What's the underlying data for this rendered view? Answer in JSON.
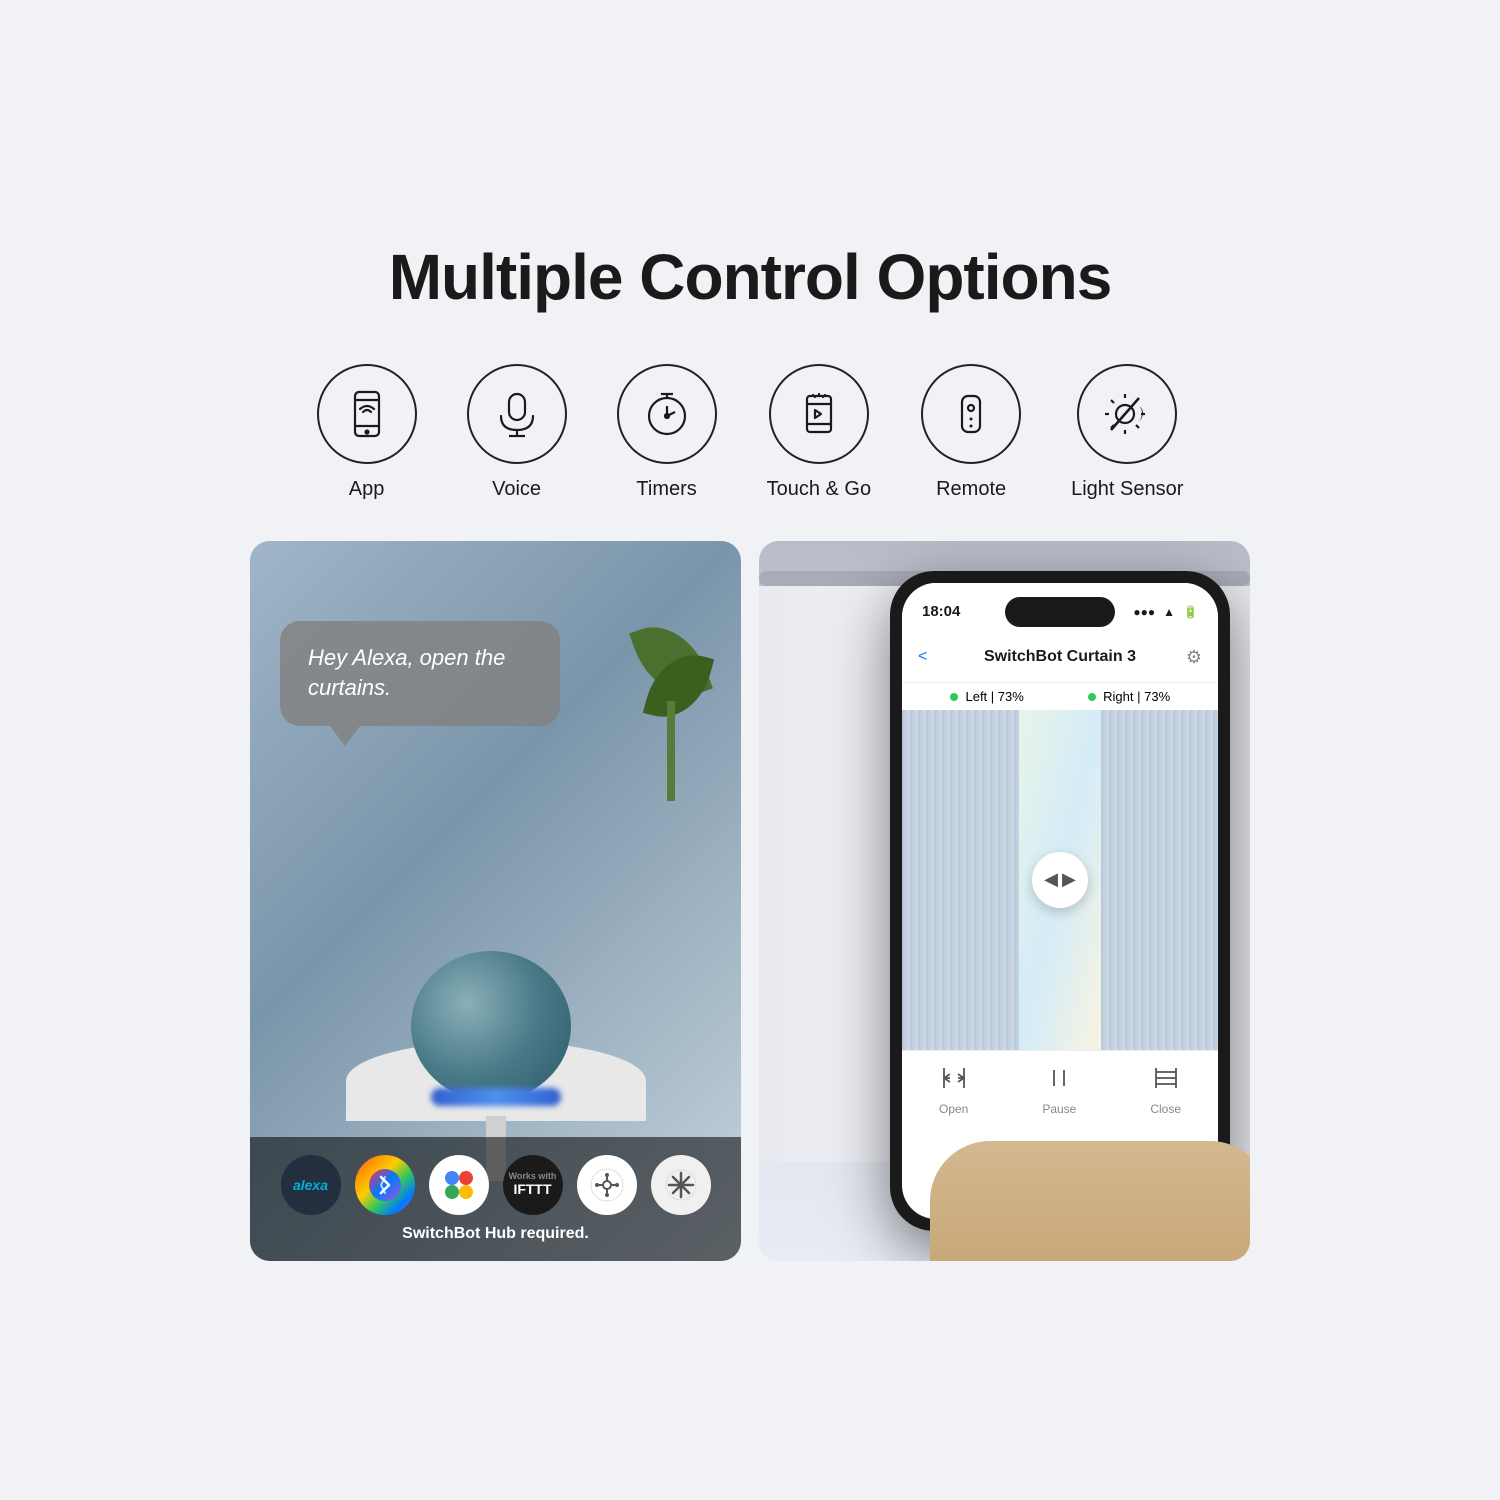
{
  "page": {
    "background_color": "#f0f2f5"
  },
  "header": {
    "title": "Multiple Control Options"
  },
  "control_icons": [
    {
      "id": "app",
      "label": "App",
      "icon": "smartphone-icon"
    },
    {
      "id": "voice",
      "label": "Voice",
      "icon": "microphone-icon"
    },
    {
      "id": "timers",
      "label": "Timers",
      "icon": "timer-icon"
    },
    {
      "id": "touch-go",
      "label": "Touch & Go",
      "icon": "touch-icon"
    },
    {
      "id": "remote",
      "label": "Remote",
      "icon": "remote-icon"
    },
    {
      "id": "light-sensor",
      "label": "Light Sensor",
      "icon": "light-sensor-icon"
    }
  ],
  "left_panel": {
    "speech_bubble": {
      "text": "Hey Alexa, open the curtains."
    },
    "logos": [
      {
        "id": "alexa",
        "label": "alexa"
      },
      {
        "id": "shortcuts",
        "label": "shortcuts"
      },
      {
        "id": "google",
        "label": "google"
      },
      {
        "id": "ifttt",
        "label": "Works with IFTTT"
      },
      {
        "id": "matter",
        "label": "matter"
      },
      {
        "id": "homekit",
        "label": "homekit"
      }
    ],
    "hub_required_text": "SwitchBot Hub required."
  },
  "right_panel": {
    "phone": {
      "time": "18:04",
      "signal_icons": "●●● ▲",
      "nav_title": "SwitchBot Curtain 3",
      "nav_back": "<",
      "nav_gear": "⚙",
      "left_status": "Left | 73%",
      "right_status": "Right | 73%",
      "bottom_controls": [
        {
          "id": "open",
          "label": "Open",
          "icon": "open-icon"
        },
        {
          "id": "pause",
          "label": "Pause",
          "icon": "pause-icon"
        },
        {
          "id": "close",
          "label": "Close",
          "icon": "close-icon"
        }
      ]
    }
  }
}
